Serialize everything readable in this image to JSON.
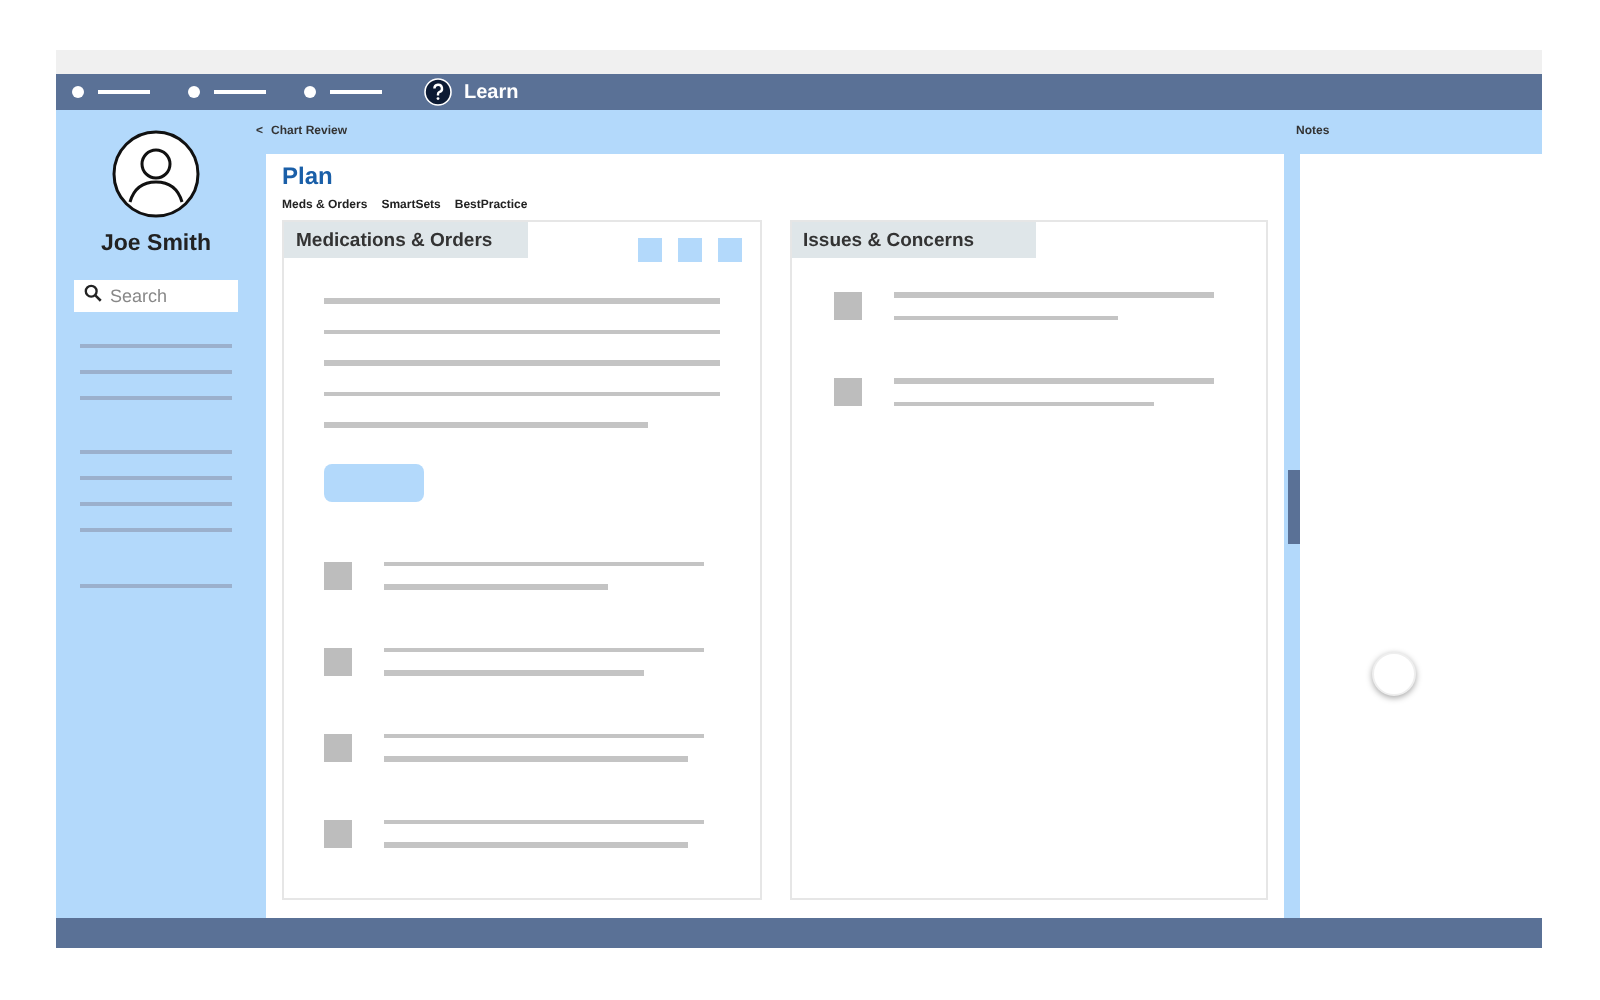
{
  "top_bar": {
    "help_label": "Learn"
  },
  "sidebar": {
    "user_name": "Joe Smith",
    "search": {
      "placeholder": "Search"
    }
  },
  "back_link": {
    "arrow": "<",
    "label": "Chart Review"
  },
  "page": {
    "title": "Plan",
    "tabs": [
      {
        "label": "Meds & Orders"
      },
      {
        "label": "SmartSets"
      },
      {
        "label": "BestPractice"
      }
    ]
  },
  "cards": [
    {
      "title": "Medications & Orders",
      "kind": "orders"
    },
    {
      "title": "Issues & Concerns",
      "kind": "issues"
    }
  ],
  "notes": {
    "title": "Notes"
  }
}
